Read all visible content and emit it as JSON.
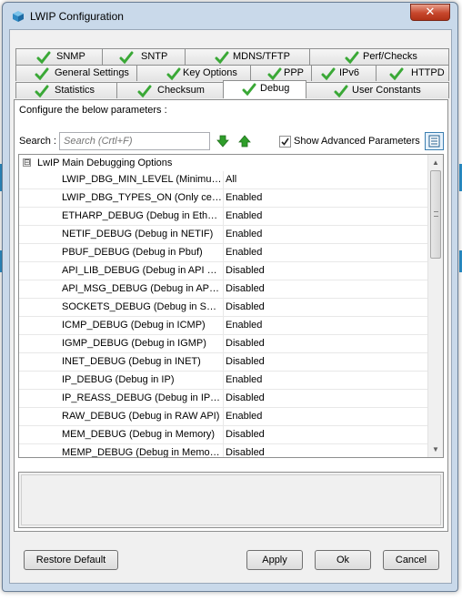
{
  "window": {
    "title": "LWIP Configuration",
    "close_glyph": "✕"
  },
  "tabs_row1": [
    {
      "label": "SNMP",
      "icon": "check-icon"
    },
    {
      "label": "SNTP",
      "icon": "check-icon"
    },
    {
      "label": "MDNS/TFTP",
      "icon": "check-icon"
    },
    {
      "label": "Perf/Checks",
      "icon": "check-icon"
    }
  ],
  "tabs_row2": [
    {
      "label": "General Settings",
      "icon": "check-icon"
    },
    {
      "label": "Key Options",
      "icon": "check-icon"
    },
    {
      "label": "PPP",
      "icon": "check-icon"
    },
    {
      "label": "IPv6",
      "icon": "check-icon"
    },
    {
      "label": "HTTPD",
      "icon": "check-icon"
    }
  ],
  "tabs_row3": [
    {
      "label": "Statistics",
      "icon": "check-icon"
    },
    {
      "label": "Checksum",
      "icon": "check-icon"
    },
    {
      "label": "Debug",
      "icon": "check-icon",
      "active": true
    },
    {
      "label": "User Constants",
      "icon": "check-icon"
    }
  ],
  "panel": {
    "configure_label": "Configure the below parameters :",
    "search_label": "Search :",
    "search_placeholder": "Search (Crtl+F)",
    "advanced_label": "Show Advanced Parameters",
    "advanced_checked": true
  },
  "tree": {
    "group_label": "LwIP Main Debugging Options",
    "expander": "⊟",
    "rows": [
      {
        "name": "LWIP_DBG_MIN_LEVEL (Minimum ...",
        "value": "All"
      },
      {
        "name": "LWIP_DBG_TYPES_ON (Only cert...",
        "value": "Enabled"
      },
      {
        "name": "ETHARP_DEBUG (Debug in Ethern...",
        "value": "Enabled"
      },
      {
        "name": "NETIF_DEBUG (Debug in NETIF)",
        "value": "Enabled"
      },
      {
        "name": "PBUF_DEBUG (Debug in Pbuf)",
        "value": "Enabled"
      },
      {
        "name": "API_LIB_DEBUG (Debug in API Lib...",
        "value": "Disabled"
      },
      {
        "name": "API_MSG_DEBUG (Debug in API M...",
        "value": "Disabled"
      },
      {
        "name": "SOCKETS_DEBUG (Debug in Socke...",
        "value": "Disabled"
      },
      {
        "name": "ICMP_DEBUG (Debug in ICMP)",
        "value": "Enabled"
      },
      {
        "name": "IGMP_DEBUG (Debug in IGMP)",
        "value": "Disabled"
      },
      {
        "name": "INET_DEBUG (Debug in INET)",
        "value": "Disabled"
      },
      {
        "name": "IP_DEBUG (Debug in IP)",
        "value": "Enabled"
      },
      {
        "name": "IP_REASS_DEBUG (Debug in IP R...",
        "value": "Disabled"
      },
      {
        "name": "RAW_DEBUG (Debug in RAW API)",
        "value": "Enabled"
      },
      {
        "name": "MEM_DEBUG (Debug in Memory)",
        "value": "Disabled"
      },
      {
        "name": "MEMP_DEBUG (Debug in Memory ...",
        "value": "Disabled"
      }
    ]
  },
  "buttons": {
    "restore_default": "Restore Default",
    "apply": "Apply",
    "ok": "Ok",
    "cancel": "Cancel"
  },
  "colors": {
    "check_green": "#3aa836",
    "arrow_green": "#2f9e2a",
    "accent_blue": "#3c7fb1"
  }
}
